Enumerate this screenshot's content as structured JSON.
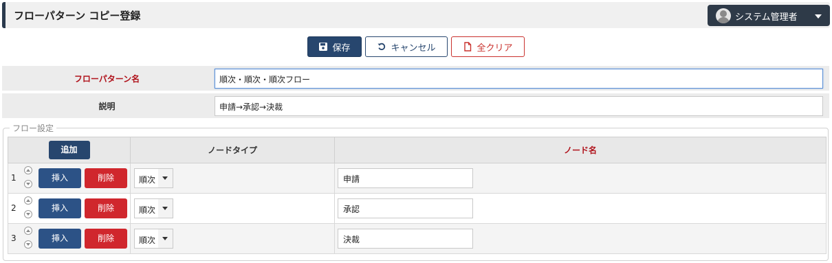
{
  "header": {
    "title": "フローパターン コピー登録",
    "user": "システム管理者"
  },
  "toolbar": {
    "save": "保存",
    "cancel": "キャンセル",
    "clear": "全クリア"
  },
  "form": {
    "name_label": "フローパターン名",
    "name_value": "順次・順次・順次フロー",
    "desc_label": "説明",
    "desc_value": "申請→承認→決裁"
  },
  "flow": {
    "legend": "フロー設定",
    "add_label": "追加",
    "col_node_type": "ノードタイプ",
    "col_node_name": "ノード名",
    "insert_label": "挿入",
    "delete_label": "削除",
    "rows": [
      {
        "num": "1",
        "type": "順次",
        "name": "申請"
      },
      {
        "num": "2",
        "type": "順次",
        "name": "承認"
      },
      {
        "num": "3",
        "type": "順次",
        "name": "決裁"
      }
    ]
  },
  "colors": {
    "primary": "#27466e",
    "danger": "#d0272d",
    "required_label": "#b0121b"
  },
  "icons": {
    "save": "floppy-disk-icon",
    "cancel": "undo-icon",
    "clear": "file-icon",
    "user": "user-avatar-icon"
  }
}
